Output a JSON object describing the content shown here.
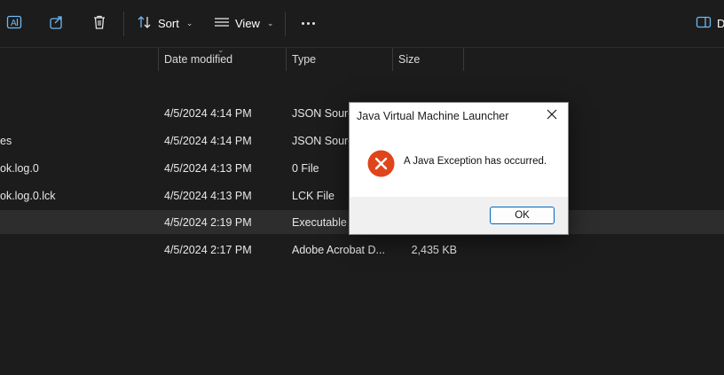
{
  "toolbar": {
    "sort_label": "Sort",
    "view_label": "View",
    "details_label": "D",
    "icons": [
      "rename-icon",
      "share-icon",
      "delete-icon",
      "sort-icon",
      "view-icon",
      "more-icon",
      "details-pane-icon"
    ]
  },
  "columns": {
    "date_modified": "Date modified",
    "type": "Type",
    "size": "Size"
  },
  "files": [
    {
      "name": "",
      "date": "4/5/2024 4:14 PM",
      "type": "JSON Source",
      "size": ""
    },
    {
      "name": "es",
      "date": "4/5/2024 4:14 PM",
      "type": "JSON Source",
      "size": ""
    },
    {
      "name": "ok.log.0",
      "date": "4/5/2024 4:13 PM",
      "type": "0 File",
      "size": ""
    },
    {
      "name": "ok.log.0.lck",
      "date": "4/5/2024 4:13 PM",
      "type": "LCK File",
      "size": ""
    },
    {
      "name": "",
      "date": "4/5/2024 2:19 PM",
      "type": "Executable J",
      "size": ""
    },
    {
      "name": "",
      "date": "4/5/2024 2:17 PM",
      "type": "Adobe Acrobat D...",
      "size": "2,435 KB"
    }
  ],
  "dialog": {
    "title": "Java Virtual Machine Launcher",
    "message": "A Java Exception has occurred.",
    "ok_label": "OK",
    "error_color": "#e0441b"
  }
}
